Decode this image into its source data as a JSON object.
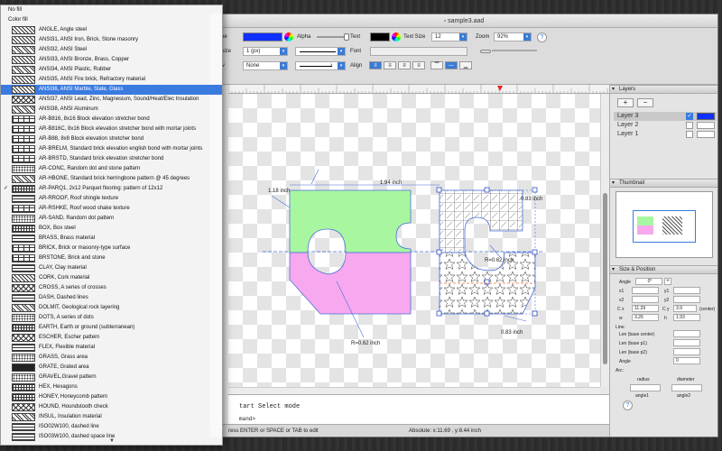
{
  "window": {
    "title": "sample3.aad"
  },
  "toolbar": {
    "line_label": "ne",
    "alpha_label": "Alpha",
    "text_label": "Text",
    "text_size_label": "Text Size",
    "text_size_value": "12",
    "zoom_label": "Zoom",
    "zoom_value": "92%",
    "line_size_label": "ne size",
    "line_size_value": "1 (px)",
    "font_label": "Font",
    "arrow_label": "rrow",
    "arrow_value": "None",
    "align_label": "Align",
    "help": "?"
  },
  "menu": {
    "items": [
      {
        "label": "No fill",
        "pattern": "none"
      },
      {
        "label": "Color fill",
        "pattern": "none"
      },
      {
        "label": "ANGLE, Angle steel",
        "pattern": "diag"
      },
      {
        "label": "ANSI31, ANSI Iron, Brick, Stone masonry",
        "pattern": "diag"
      },
      {
        "label": "ANSI32, ANSI Steel",
        "pattern": "diag2"
      },
      {
        "label": "ANSI33, ANSI Bronze, Brass, Copper",
        "pattern": "diag"
      },
      {
        "label": "ANSI34, ANSI Plastic, Rubber",
        "pattern": "diag2"
      },
      {
        "label": "ANSI35, ANSI Fire brick, Refractory material",
        "pattern": "diag"
      },
      {
        "label": "ANSI36, ANSI Marble, Slate, Glass",
        "pattern": "diag"
      },
      {
        "label": "ANSI37, ANSI Lead, Zinc, Magnesium, Sound/Heat/Elec Insulation",
        "pattern": "cross"
      },
      {
        "label": "ANSI38, ANSI Aluminum",
        "pattern": "diag2"
      },
      {
        "label": "AR-B816, 8x16 Block elevation stretcher bond",
        "pattern": "brick"
      },
      {
        "label": "AR-B816C, 8x16 Block elevation stretcher bond with mortar joints",
        "pattern": "brick"
      },
      {
        "label": "AR-B88, 8x8 Block elevation stretcher bond",
        "pattern": "brick"
      },
      {
        "label": "AR-BRELM, Standard brick elevation english bond with mortar joints",
        "pattern": "brick"
      },
      {
        "label": "AR-BRSTD, Standard brick elevation stretcher bond",
        "pattern": "brick"
      },
      {
        "label": "AR-CONC, Random dot and stone pattern",
        "pattern": "dots"
      },
      {
        "label": "AR-HBONE, Standard brick herringbone pattern @ 45 degrees",
        "pattern": "diag2"
      },
      {
        "label": "AR-PARQ1, 2x12 Parquet flooring: pattern of 12x12",
        "pattern": "grid"
      },
      {
        "label": "AR-RROOF, Roof shingle texture",
        "pattern": "hlines"
      },
      {
        "label": "AR-RSHKE, Roof wood shake texture",
        "pattern": "brick"
      },
      {
        "label": "AR-SAND, Random dot pattern",
        "pattern": "dots"
      },
      {
        "label": "BOX, Box steel",
        "pattern": "grid"
      },
      {
        "label": "BRASS, Brass material",
        "pattern": "hlines"
      },
      {
        "label": "BRICK, Brick or masonry-type surface",
        "pattern": "brick"
      },
      {
        "label": "BRSTONE, Brick and stone",
        "pattern": "brick"
      },
      {
        "label": "CLAY, Clay material",
        "pattern": "hlines"
      },
      {
        "label": "CORK, Cork material",
        "pattern": "diag"
      },
      {
        "label": "CROSS, A series of crosses",
        "pattern": "cross"
      },
      {
        "label": "DASH, Dashed lines",
        "pattern": "hlines"
      },
      {
        "label": "DOLMIT, Geological rock layering",
        "pattern": "diag2"
      },
      {
        "label": "DOTS, A series of dots",
        "pattern": "dots"
      },
      {
        "label": "EARTH, Earth or ground (subterranean)",
        "pattern": "grid"
      },
      {
        "label": "ESCHER, Escher pattern",
        "pattern": "cross"
      },
      {
        "label": "FLEX, Flexible material",
        "pattern": "hlines"
      },
      {
        "label": "GRASS, Grass area",
        "pattern": "dots"
      },
      {
        "label": "GRATE, Grated area",
        "pattern": "solid"
      },
      {
        "label": "GRAVEL,Gravel pattern",
        "pattern": "dots"
      },
      {
        "label": "HEX, Hexagons",
        "pattern": "grid"
      },
      {
        "label": "HONEY, Honeycomb pattern",
        "pattern": "grid"
      },
      {
        "label": "HOUND, Houndstooth check",
        "pattern": "cross"
      },
      {
        "label": "INSUL, Insulation material",
        "pattern": "diag2"
      },
      {
        "label": "ISO02W100, dashed line",
        "pattern": "hlines"
      },
      {
        "label": "ISO03W100, dashed space line",
        "pattern": "hlines"
      }
    ],
    "highlighted_index": 8,
    "checked_index": 18,
    "checkmark": "✓",
    "scroll_arrow": "▼"
  },
  "drawing": {
    "dimensions": [
      "1.94 inch",
      "1.18 inch",
      "0.83 inch",
      "R=0.62 inch",
      "0.83 inch",
      "R=0.62 inch"
    ]
  },
  "command": {
    "line1": "tart Select mode",
    "line2": "mand>"
  },
  "status": {
    "hint": "ress ENTER or SPACE or TAB to edit",
    "position": "Absolute: x:11.69 , y:8.44 inch"
  },
  "layers": {
    "header": "Layers",
    "add": "+",
    "remove": "−",
    "items": [
      "Layer 3",
      "Layer 2",
      "Layer 1"
    ],
    "checkmark": "✓"
  },
  "thumbnail": {
    "header": "Thumbnail"
  },
  "size_position": {
    "header": "Size & Position",
    "angle_label": "Angle",
    "angle_value": "0°",
    "x1_label": "x1",
    "y1_label": "y1",
    "x2_label": "x2",
    "y2_label": "y2",
    "cx_label": "C x",
    "cx_value": "11.29",
    "cy_label": "C y",
    "cy_value": "3.9",
    "center_label": "(center)",
    "w_label": "w",
    "w_value": "3.26",
    "h_label": "h",
    "h_value": "1.93",
    "line_header": "Line:",
    "len_center_label": "Len (base center)",
    "len_p1_label": "Len (base p1)",
    "len_p2_label": "Len (base p2)",
    "line_angle_label": "Angle",
    "line_angle_value": "0",
    "arc_header": "Arc:",
    "radius_label": "radius",
    "diameter_label": "diameter",
    "angle1_label": "angle1",
    "angle2_label": "angle2",
    "help": "?"
  },
  "colors": {
    "line_color": "#1030ff",
    "text_color": "#000000",
    "green_fill": "#a8f7a0",
    "pink_fill": "#f7a8ee",
    "selection": "#3a7be0",
    "layer3_color": "#1030ff"
  }
}
